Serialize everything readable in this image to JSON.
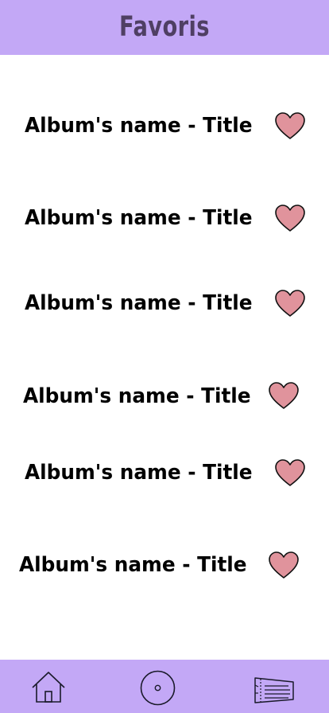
{
  "header": {
    "title": "Favoris"
  },
  "favorites": [
    {
      "label": "Album's name - Title",
      "icon": "heart-icon"
    },
    {
      "label": "Album's name - Title",
      "icon": "heart-icon"
    },
    {
      "label": "Album's name - Title",
      "icon": "heart-icon"
    },
    {
      "label": "Album's name - Title",
      "icon": "heart-icon"
    },
    {
      "label": "Album's name - Title",
      "icon": "heart-icon"
    },
    {
      "label": "Album's name - Title",
      "icon": "heart-icon"
    }
  ],
  "bottom_nav": {
    "items": [
      {
        "icon": "home-icon"
      },
      {
        "icon": "disc-icon"
      },
      {
        "icon": "ticket-icon"
      }
    ]
  },
  "colors": {
    "bar_background": "#c3a8f6",
    "title_text": "#4f3f63",
    "heart_fill": "#e0939c",
    "text": "#000000"
  }
}
